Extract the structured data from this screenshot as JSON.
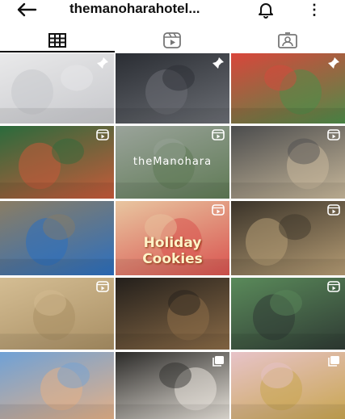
{
  "header": {
    "username": "themanoharahotel...",
    "back_icon": "arrow-left-icon",
    "notification_icon": "bell-icon",
    "more_icon": "more-vertical-icon",
    "more_glyph": "⋮"
  },
  "tabs": [
    {
      "name": "grid",
      "icon": "grid-icon",
      "active": true
    },
    {
      "name": "reels",
      "icon": "reels-icon",
      "active": false
    },
    {
      "name": "tagged",
      "icon": "tagged-icon",
      "active": false
    }
  ],
  "posts": [
    {
      "id": "p1",
      "badge": "pin-icon",
      "scene": "bathrobe woman on bed",
      "colors": [
        "#e9e9ea",
        "#c7c8cc"
      ]
    },
    {
      "id": "p2",
      "badge": "pin-icon",
      "scene": "group photo dark hall",
      "colors": [
        "#2a2d33",
        "#6b6e74"
      ]
    },
    {
      "id": "p3",
      "badge": "pin-icon",
      "scene": "christmas girl in red",
      "colors": [
        "#d9463b",
        "#4e8c49"
      ]
    },
    {
      "id": "p4",
      "badge": "reels-icon",
      "scene": "christmas wreath",
      "colors": [
        "#2a6b3c",
        "#c75a3a"
      ]
    },
    {
      "id": "p5",
      "badge": "reels-icon",
      "scene": "hotel logo sign",
      "text": "theManohara",
      "colors": [
        "#9aa39a",
        "#5f7a55"
      ]
    },
    {
      "id": "p6",
      "badge": "reels-icon",
      "scene": "hotel building",
      "colors": [
        "#4b4c4d",
        "#c7b79a"
      ]
    },
    {
      "id": "p7",
      "badge": "",
      "scene": "group in blue shirts",
      "colors": [
        "#8a7d64",
        "#2c6fbf"
      ]
    },
    {
      "id": "p8",
      "badge": "reels-icon",
      "scene": "holiday cookies",
      "text": "Holiday Cookies",
      "colors": [
        "#e8c6a0",
        "#d9534f"
      ]
    },
    {
      "id": "p9",
      "badge": "reels-icon",
      "scene": "woman in library",
      "colors": [
        "#3a3329",
        "#b59c74"
      ]
    },
    {
      "id": "p10",
      "badge": "reels-icon",
      "scene": "rattan sun",
      "colors": [
        "#d4bd93",
        "#a98f64"
      ]
    },
    {
      "id": "p11",
      "badge": "",
      "scene": "bar interior",
      "colors": [
        "#231f1b",
        "#8a6b47"
      ]
    },
    {
      "id": "p12",
      "badge": "reels-icon",
      "scene": "balcony forest view",
      "colors": [
        "#5a8a5a",
        "#2f3b34"
      ]
    },
    {
      "id": "p13",
      "badge": "",
      "scene": "pool at sunset",
      "colors": [
        "#6fa1d6",
        "#e3b087"
      ]
    },
    {
      "id": "p14",
      "badge": "carousel-icon",
      "scene": "woman at table",
      "colors": [
        "#2b2a28",
        "#e7e2da"
      ]
    },
    {
      "id": "p15",
      "badge": "carousel-icon",
      "scene": "floral decoration",
      "colors": [
        "#e7c3c9",
        "#c9a651"
      ]
    }
  ]
}
